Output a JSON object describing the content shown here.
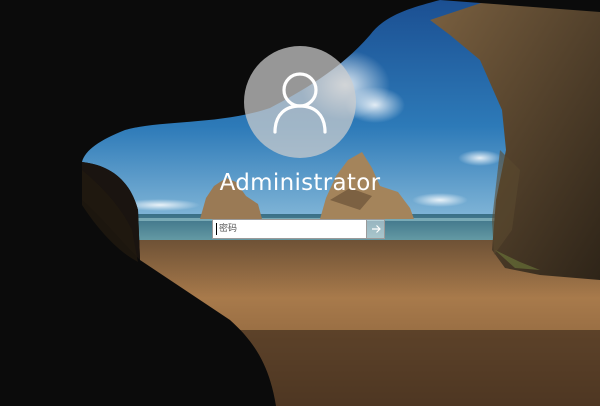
{
  "user": {
    "name": "Administrator",
    "avatar_icon": "person-icon"
  },
  "password": {
    "placeholder": "密码",
    "value": ""
  },
  "submit": {
    "icon": "arrow-right-icon"
  },
  "colors": {
    "sky": "#1f5d9e",
    "sand": "#b38252",
    "cave": "#0a0a0a",
    "avatar_bg": "#cdcdcd"
  }
}
